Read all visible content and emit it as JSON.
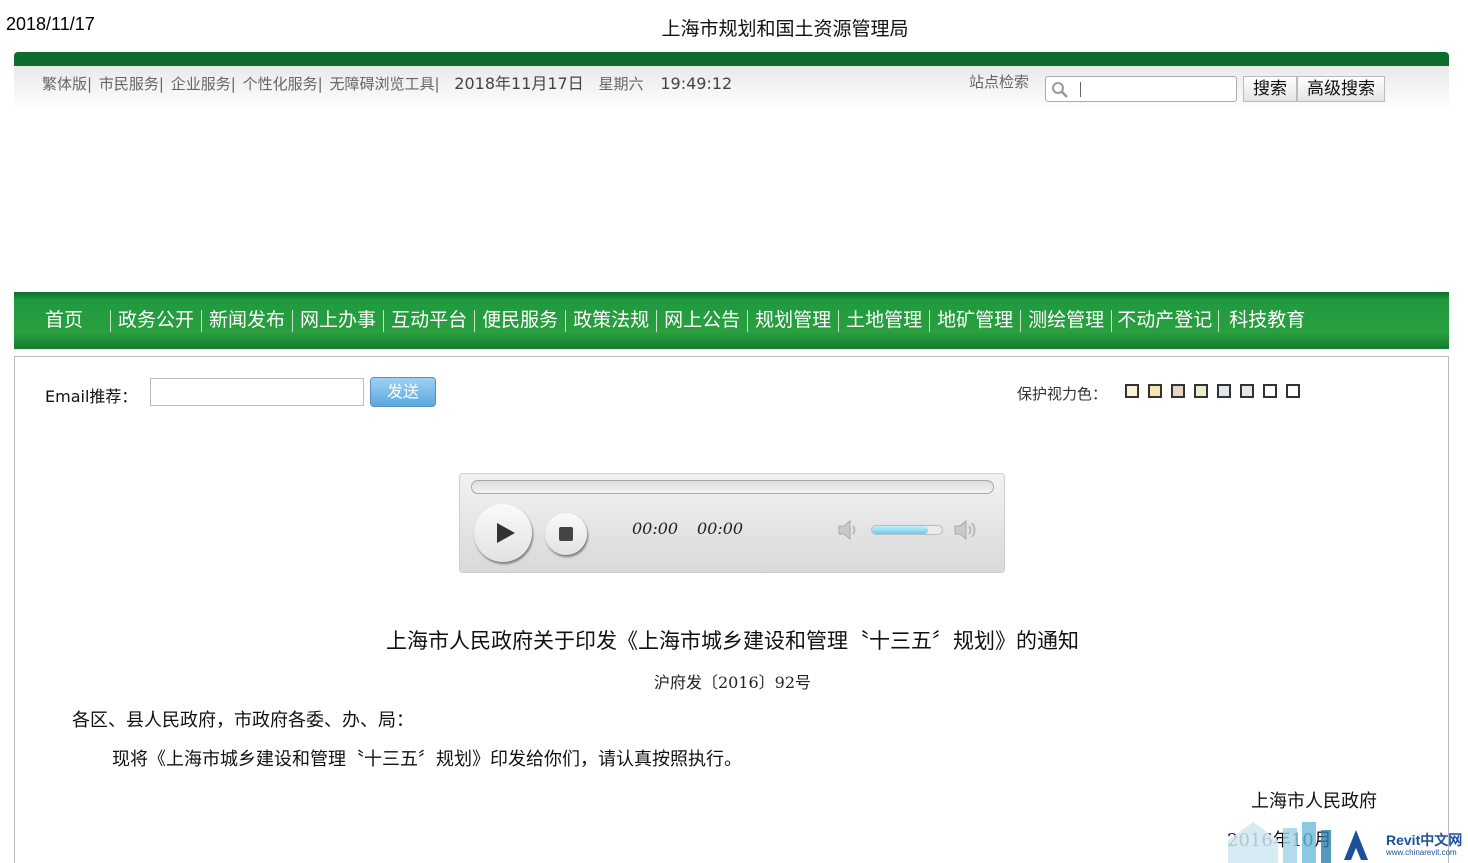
{
  "print_header": {
    "date": "2018/11/17",
    "title": "上海市规划和国土资源管理局"
  },
  "top_bar": {
    "links": [
      "繁体版",
      "市民服务",
      "企业服务",
      "个性化服务",
      "无障碍浏览工具"
    ],
    "separator": "|",
    "date": "2018年11月17日",
    "weekday": "星期六",
    "time": "19:49:12",
    "site_search_label": "站点检索",
    "search_placeholder": "",
    "search_button": "搜索",
    "advanced_search_button": "高级搜索"
  },
  "nav": {
    "items": [
      "首页",
      "政务公开",
      "新闻发布",
      "网上办事",
      "互动平台",
      "便民服务",
      "政策法规",
      "网上公告",
      "规划管理",
      "土地管理",
      "地矿管理",
      "测绘管理",
      "不动产登记",
      "科技教育"
    ]
  },
  "email": {
    "label": "Email推荐：",
    "value": "",
    "send_button": "发送"
  },
  "eye_protection": {
    "label": "保护视力色：",
    "swatches": [
      "#fbf3d3",
      "#f3e6b3",
      "#e9d5c5",
      "#e7eecd",
      "#dfe7ee",
      "#e6e6e6",
      "#ffffff",
      "#ffffff"
    ]
  },
  "player": {
    "current_time": "00:00",
    "duration": "00:00",
    "volume_level": 0.8
  },
  "document": {
    "title": "上海市人民政府关于印发《上海市城乡建设和管理〝十三五〞规划》的通知",
    "number": "沪府发〔2016〕92号",
    "salutation": "各区、县人民政府，市政府各委、办、局：",
    "body": "现将《上海市城乡建设和管理〝十三五〞规划》印发给你们，请认真按照执行。",
    "signer": "上海市人民政府",
    "date": "2016年10月"
  },
  "watermark": {
    "brand": "Revit中文网",
    "url": "www.chinarevit.com"
  },
  "colors": {
    "nav_green": "#1f9a3f",
    "send_blue": "#5aa9df"
  }
}
